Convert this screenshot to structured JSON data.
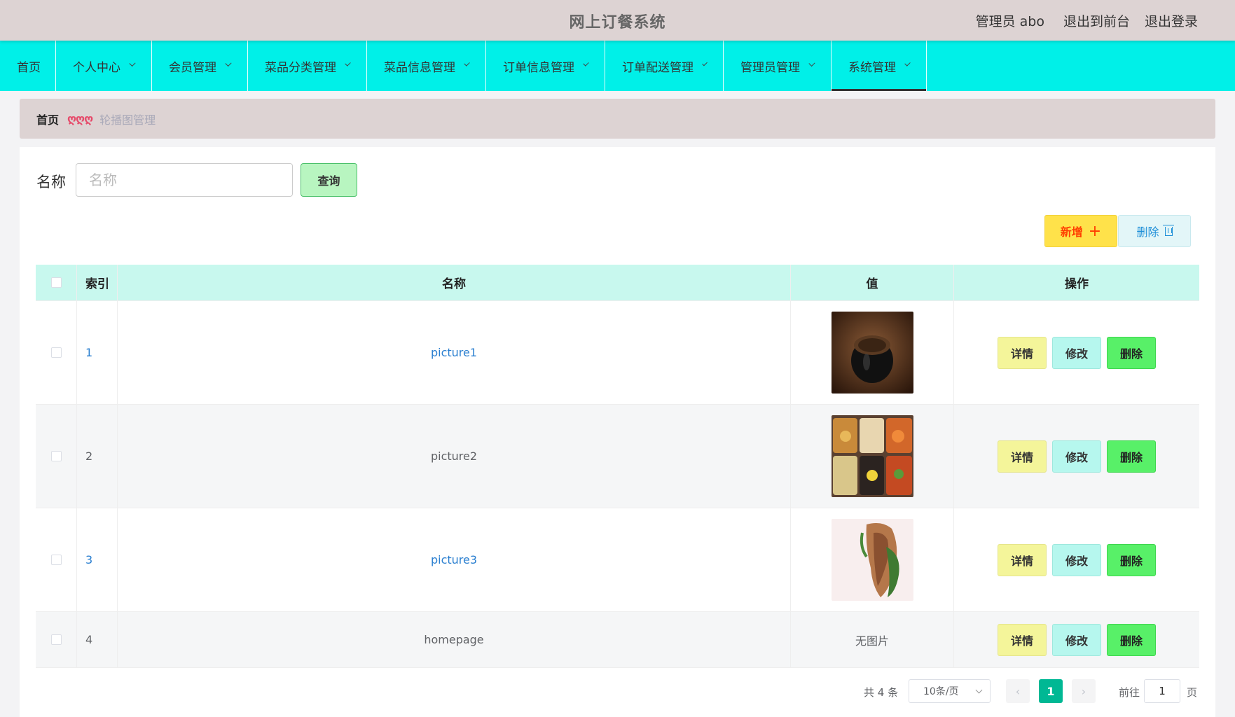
{
  "header": {
    "title": "网上订餐系统",
    "user": "管理员 abo",
    "to_front": "退出到前台",
    "logout": "退出登录"
  },
  "nav": {
    "items": [
      {
        "label": "首页",
        "dropdown": false,
        "active": false
      },
      {
        "label": "个人中心",
        "dropdown": true,
        "active": false
      },
      {
        "label": "会员管理",
        "dropdown": true,
        "active": false
      },
      {
        "label": "菜品分类管理",
        "dropdown": true,
        "active": false
      },
      {
        "label": "菜品信息管理",
        "dropdown": true,
        "active": false
      },
      {
        "label": "订单信息管理",
        "dropdown": true,
        "active": false
      },
      {
        "label": "订单配送管理",
        "dropdown": true,
        "active": false
      },
      {
        "label": "管理员管理",
        "dropdown": true,
        "active": false
      },
      {
        "label": "系统管理",
        "dropdown": true,
        "active": true
      }
    ]
  },
  "breadcrumb": {
    "home": "首页",
    "separator": "ღღღ",
    "current": "轮播图管理"
  },
  "search": {
    "label": "名称",
    "placeholder": "名称",
    "value": "",
    "button": "查询"
  },
  "actions": {
    "add": "新增",
    "delete": "删除"
  },
  "table": {
    "headers": {
      "index": "索引",
      "name": "名称",
      "value": "值",
      "ops": "操作"
    },
    "rows": [
      {
        "index": "1",
        "name": "picture1",
        "image": "coffee",
        "no_image": ""
      },
      {
        "index": "2",
        "name": "picture2",
        "image": "dishes",
        "no_image": ""
      },
      {
        "index": "3",
        "name": "picture3",
        "image": "food",
        "no_image": ""
      },
      {
        "index": "4",
        "name": "homepage",
        "image": "",
        "no_image": "无图片"
      }
    ],
    "op_labels": {
      "detail": "详情",
      "edit": "修改",
      "delete": "删除"
    }
  },
  "pagination": {
    "total": "共 4 条",
    "page_size": "10条/页",
    "current_page": "1",
    "goto_label": "前往",
    "goto_value": "1",
    "page_suffix": "页"
  },
  "colors": {
    "nav_bg": "#00f0e8",
    "header_bg": "#ddd3d3",
    "table_head_bg": "#c8f8ee",
    "accent_green": "#00b894"
  }
}
